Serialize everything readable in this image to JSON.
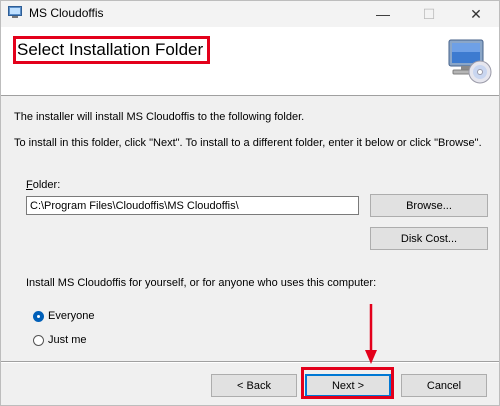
{
  "window": {
    "title": "MS Cloudoffis",
    "controls": {
      "minimize": "—",
      "maximize": "☐",
      "close": "✕"
    },
    "icon": "installer-app-icon"
  },
  "header": {
    "title": "Select Installation Folder",
    "icon": "computer-disc-icon"
  },
  "body": {
    "intro_line1": "The installer will install MS Cloudoffis to the following folder.",
    "intro_line2": "To install in this folder, click \"Next\". To install to a different folder, enter it below or click \"Browse\".",
    "folder_label_accel": "F",
    "folder_label_rest": "older:",
    "folder_value": "C:\\Program Files\\Cloudoffis\\MS Cloudoffis\\",
    "browse_label": "Browse...",
    "disk_cost_label": "Disk Cost...",
    "install_for_label": "Install MS Cloudoffis for yourself, or for anyone who uses this computer:",
    "radio_everyone": "Everyone",
    "radio_just_me": "Just me",
    "selected_option": "Everyone"
  },
  "footer": {
    "back_label": "< Back",
    "next_label": "Next >",
    "cancel_label": "Cancel"
  },
  "annotations": {
    "highlight_color": "#e3001b"
  }
}
